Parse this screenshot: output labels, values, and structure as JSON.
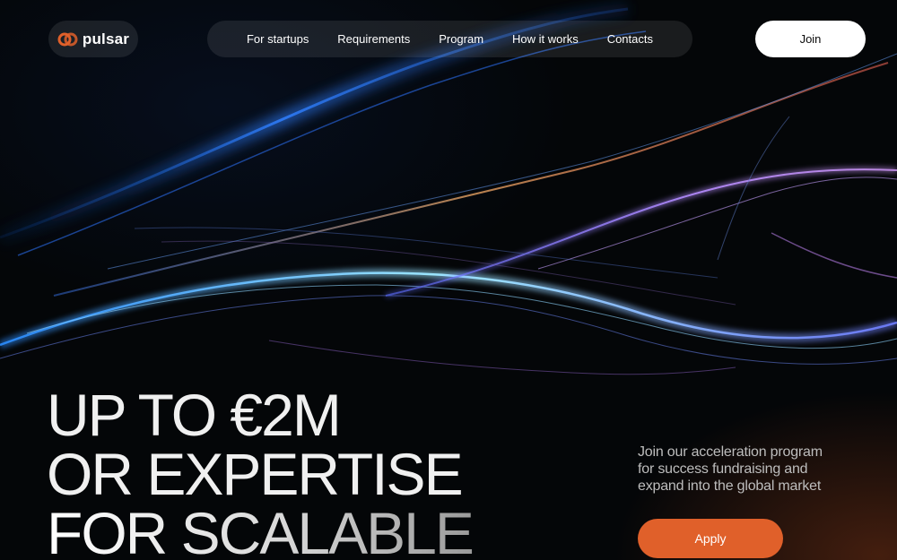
{
  "brand": {
    "name": "pulsar",
    "logo_icon": "pulsar-logo-icon",
    "logo_color": "#e0602a"
  },
  "nav": {
    "items": [
      {
        "label": "For startups"
      },
      {
        "label": "Requirements"
      },
      {
        "label": "Program"
      },
      {
        "label": "How it works"
      },
      {
        "label": "Contacts"
      }
    ]
  },
  "header": {
    "join_label": "Join"
  },
  "hero": {
    "headline_lines": [
      "UP TO €2M",
      "OR EXPERTISE",
      "FOR SCALABLE"
    ],
    "subtext_lines": [
      "Join our acceleration program",
      "for success fundraising and",
      "expand into the global market"
    ],
    "apply_label": "Apply"
  },
  "colors": {
    "accent": "#e0602a",
    "background": "#040608",
    "pill": "rgba(255,255,255,0.09)"
  }
}
